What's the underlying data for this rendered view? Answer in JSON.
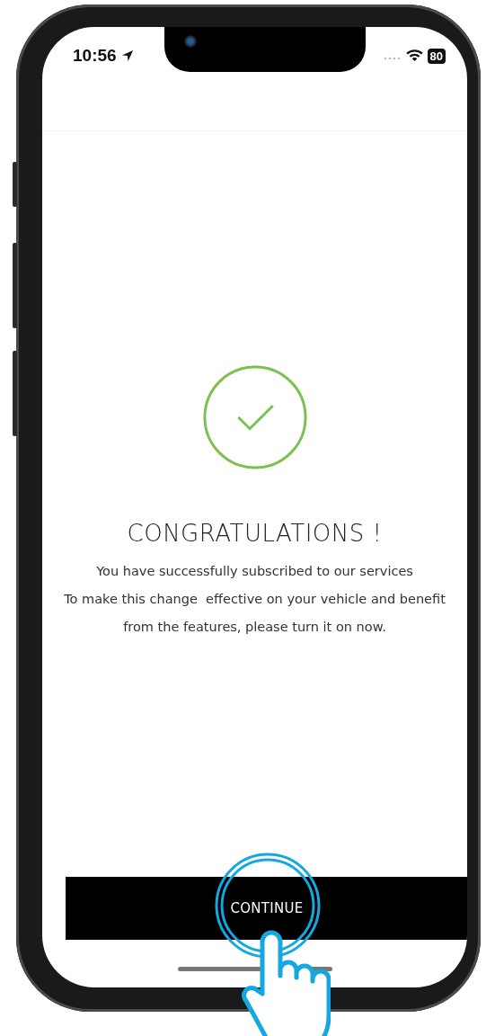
{
  "status_bar": {
    "time": "10:56",
    "battery": "80"
  },
  "title": "CONGRATULATIONS !",
  "message": [
    "You have successfully subscribed to our services",
    "To make this change  effective on your vehicle and benefit from the features, please turn it on now."
  ],
  "button": {
    "label": "CONTINUE"
  }
}
